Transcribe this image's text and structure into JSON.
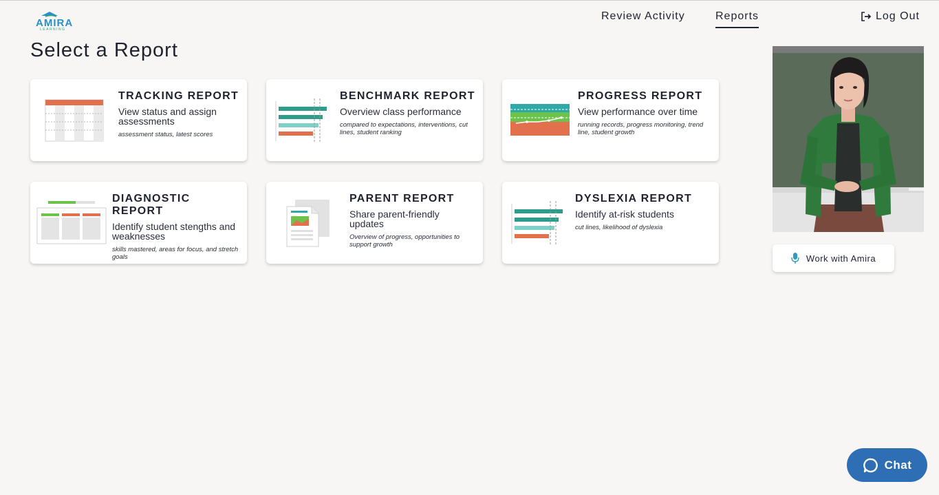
{
  "brand": {
    "name": "AMIRA",
    "tagline": "LEARNING"
  },
  "nav": {
    "review_activity": "Review Activity",
    "reports": "Reports",
    "logout": "Log Out"
  },
  "page_title": "Select a Report",
  "reports": [
    {
      "title": "TRACKING REPORT",
      "subtitle": "View status and assign assessments",
      "details": "assessment status, latest scores"
    },
    {
      "title": "BENCHMARK REPORT",
      "subtitle": "Overview class performance",
      "details": "compared to expectations, interventions, cut lines, student ranking"
    },
    {
      "title": "PROGRESS REPORT",
      "subtitle": "View performance over time",
      "details": "running records, progress monitoring, trend line, student growth"
    },
    {
      "title": "DIAGNOSTIC REPORT",
      "subtitle": "Identify student stengths and weaknesses",
      "details": "skills mastered, areas for focus, and stretch goals"
    },
    {
      "title": "PARENT REPORT",
      "subtitle": "Share parent-friendly updates",
      "details": "Overview of progress, opportunities to support growth"
    },
    {
      "title": "DYSLEXIA REPORT",
      "subtitle": "Identify at-risk students",
      "details": "cut lines, likelihood of dyslexia"
    }
  ],
  "assistant": {
    "button_label": "Work with Amira"
  },
  "chat": {
    "label": "Chat"
  },
  "colors": {
    "accent_blue": "#2e6eb4",
    "teal": "#2e9c8a",
    "orange": "#e2704d",
    "green": "#6cc24a"
  }
}
